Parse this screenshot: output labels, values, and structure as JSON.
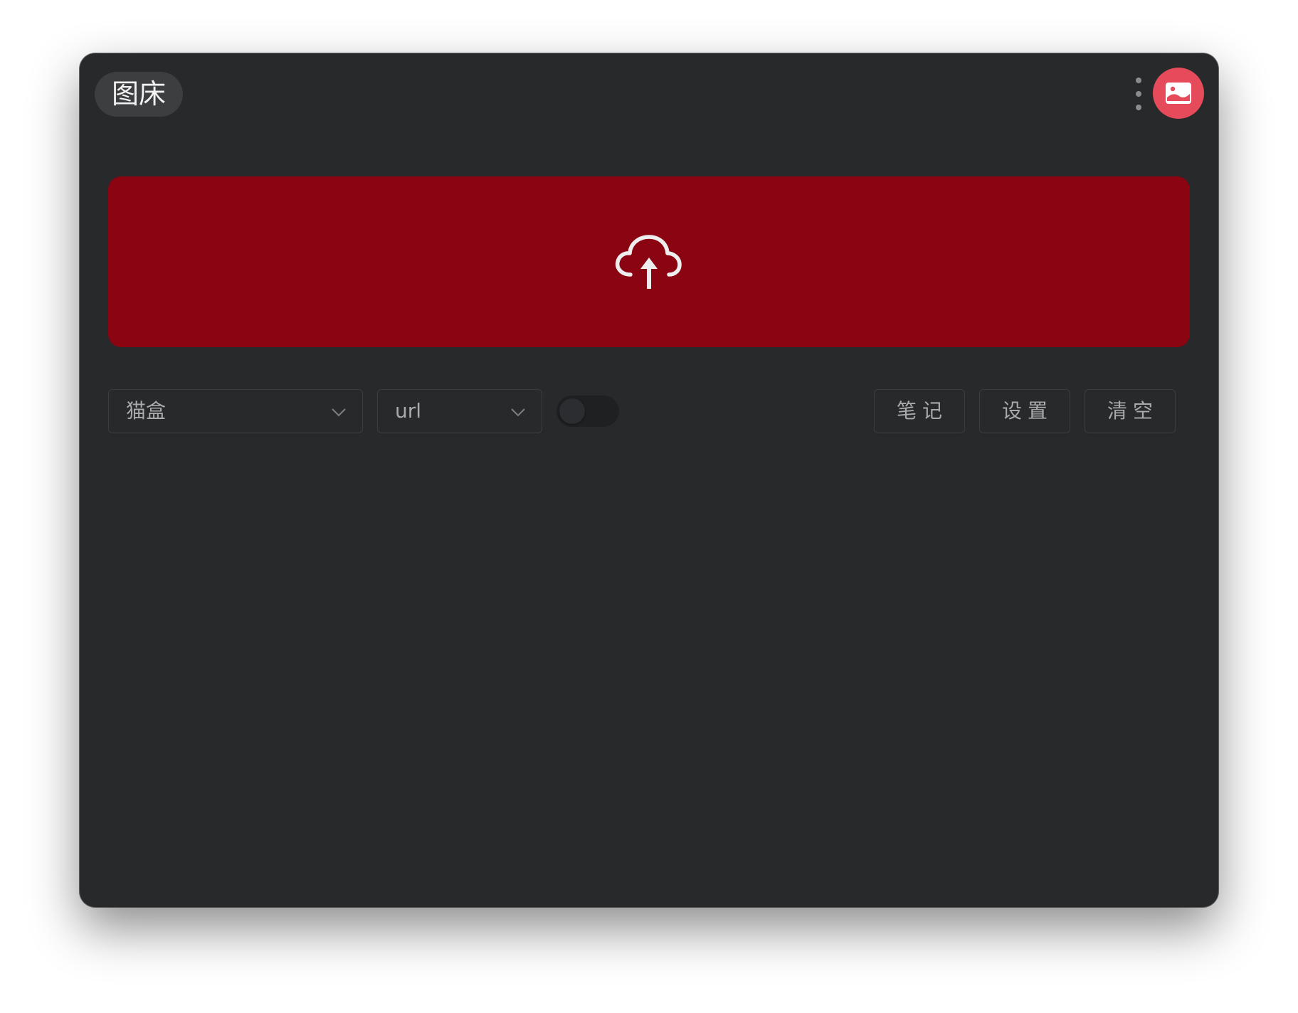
{
  "app": {
    "title": "图床"
  },
  "header": {
    "menu_icon": "vertical-dots-icon",
    "app_icon": "image-icon",
    "app_icon_color": "#e54b5a"
  },
  "upload": {
    "icon": "cloud-upload-icon",
    "background": "#8a0412"
  },
  "controls": {
    "host_select": {
      "value": "猫盒"
    },
    "format_select": {
      "value": "url"
    },
    "toggle": {
      "on": false
    },
    "buttons": {
      "notes": "笔记",
      "settings": "设置",
      "clear": "清空"
    }
  },
  "theme": {
    "window_bg": "#28292b",
    "text_muted": "#a9aaac"
  }
}
